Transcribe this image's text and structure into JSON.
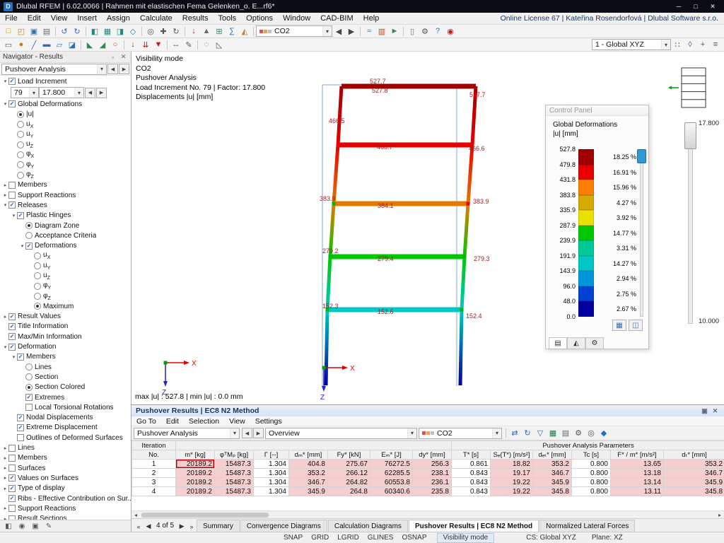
{
  "ui": {
    "combo_arrow": "▾"
  },
  "window": {
    "app_icon": "D",
    "title": "Dlubal RFEM | 6.02.0066 | Rahmen mit elastischen Fema Gelenken_o. E...rf6*",
    "controls": [
      {
        "n": "minimize-button",
        "g": "─"
      },
      {
        "n": "maximize-button",
        "g": "□"
      },
      {
        "n": "close-button",
        "g": "✕"
      }
    ]
  },
  "menu": {
    "items": [
      "File",
      "Edit",
      "View",
      "Insert",
      "Assign",
      "Calculate",
      "Results",
      "Tools",
      "Options",
      "Window",
      "CAD-BIM",
      "Help"
    ],
    "license": "Online License 67 | Kateřina Rosendorfová | Dlubal Software s.r.o."
  },
  "toolbar1": {
    "icons": [
      {
        "n": "new-file-icon",
        "g": "□",
        "c": "#C98A00"
      },
      {
        "n": "open-file-icon",
        "g": "◰",
        "c": "#C98A00"
      },
      {
        "n": "save-icon",
        "g": "▣",
        "c": "#2F6DB5"
      },
      {
        "n": "print-icon",
        "g": "▤",
        "c": "#5A6B7A"
      },
      {
        "sep": true
      },
      {
        "n": "undo-icon",
        "g": "↺",
        "c": "#2F6DB5"
      },
      {
        "n": "redo-icon",
        "g": "↻",
        "c": "#2F6DB5"
      },
      {
        "sep": true
      },
      {
        "n": "navigator-panel-icon",
        "g": "◧",
        "c": "#1F8A8A"
      },
      {
        "n": "tables-panel-icon",
        "g": "▦",
        "c": "#1F8A8A"
      },
      {
        "n": "control-panel-icon",
        "g": "◨",
        "c": "#1F8A8A"
      },
      {
        "n": "render-mode-icon",
        "g": "◇",
        "c": "#2F6DB5"
      },
      {
        "sep": true
      },
      {
        "n": "zoom-icon",
        "g": "◎",
        "c": "#555555"
      },
      {
        "n": "pan-icon",
        "g": "✚",
        "c": "#555555"
      },
      {
        "n": "rotate-view-icon",
        "g": "↻",
        "c": "#555555"
      },
      {
        "sep": true
      },
      {
        "n": "loads-icon",
        "g": "↓",
        "c": "#C01818"
      },
      {
        "n": "supports-icon",
        "g": "▲",
        "c": "#6A6A6A"
      },
      {
        "n": "mesh-icon",
        "g": "⊞",
        "c": "#2E8B57"
      },
      {
        "n": "calculate-icon",
        "g": "∑",
        "c": "#2F6DB5"
      },
      {
        "n": "show-results-icon",
        "g": "◭",
        "c": "#C07818"
      },
      {
        "sep": true
      }
    ],
    "co2_label": "CO2",
    "co2_swatches": [
      "#E05050",
      "#F0A050",
      "#C0C0C0"
    ],
    "icons2": [
      {
        "n": "previous-result-button",
        "g": "◀",
        "c": "#444444"
      },
      {
        "n": "next-result-button",
        "g": "▶",
        "c": "#444444"
      },
      {
        "sep": true
      },
      {
        "n": "result-values-icon",
        "g": "≈",
        "c": "#2F6DB5"
      },
      {
        "n": "colored-diagram-icon",
        "g": "▥",
        "c": "#C04818"
      },
      {
        "n": "animation-icon",
        "g": "►",
        "c": "#2E8B57"
      },
      {
        "sep": true
      },
      {
        "n": "clipboard-icon",
        "g": "▯",
        "c": "#777777"
      },
      {
        "n": "settings-icon",
        "g": "⚙",
        "c": "#555555"
      },
      {
        "n": "help-icon",
        "g": "?",
        "c": "#1F6FC4"
      },
      {
        "n": "search-icon",
        "g": "◉",
        "c": "#C01818"
      }
    ]
  },
  "toolbar2": {
    "icons": [
      {
        "n": "select-arrow-icon",
        "g": "▭",
        "c": "#555555"
      },
      {
        "n": "node-tool-icon",
        "g": "●",
        "c": "#C07818"
      },
      {
        "n": "line-tool-icon",
        "g": "╱",
        "c": "#2F6DB5"
      },
      {
        "n": "member-tool-icon",
        "g": "▬",
        "c": "#2F6DB5"
      },
      {
        "n": "surface-tool-icon",
        "g": "▱",
        "c": "#2F6DB5"
      },
      {
        "n": "solid-tool-icon",
        "g": "◪",
        "c": "#2F6DB5"
      },
      {
        "sep": true
      },
      {
        "n": "nodal-support-icon",
        "g": "◣",
        "c": "#2E8B57"
      },
      {
        "n": "line-support-icon",
        "g": "◢",
        "c": "#2E8B57"
      },
      {
        "n": "member-hinge-icon",
        "g": "○",
        "c": "#C04818"
      },
      {
        "sep": true
      },
      {
        "n": "nodal-load-icon",
        "g": "↓",
        "c": "#C01818"
      },
      {
        "n": "member-load-icon",
        "g": "⇊",
        "c": "#C01818"
      },
      {
        "n": "surface-load-icon",
        "g": "▼",
        "c": "#C01818"
      },
      {
        "sep": true
      },
      {
        "n": "dimension-icon",
        "g": "↔",
        "c": "#555555"
      },
      {
        "n": "annotation-icon",
        "g": "✎",
        "c": "#555555"
      },
      {
        "sep": true
      },
      {
        "n": "visibility-mode-icon",
        "g": "◌",
        "c": "#1F8A8A"
      },
      {
        "n": "section-view-icon",
        "g": "◺",
        "c": "#555555"
      }
    ],
    "cs_label": "1 - Global XYZ",
    "icons2": [
      {
        "n": "grid-settings-icon",
        "g": "∷",
        "c": "#555555"
      },
      {
        "n": "work-plane-icon",
        "g": "◊",
        "c": "#2F6DB5"
      },
      {
        "n": "snap-icon",
        "g": "+",
        "c": "#555555"
      },
      {
        "n": "guidelines-icon",
        "g": "≡",
        "c": "#555555"
      }
    ]
  },
  "navigator": {
    "title": "Navigator - Results",
    "header_icons": [
      {
        "n": "auto-hide-icon",
        "g": "▫",
        "c": "#666666"
      },
      {
        "n": "close-navigator-icon",
        "g": "✕",
        "c": "#666666"
      }
    ],
    "combo": "Pushover Analysis",
    "combo_nav": [
      {
        "n": "previous-analysis-button",
        "g": "◀",
        "c": "#444444"
      },
      {
        "n": "next-analysis-button",
        "g": "▶",
        "c": "#444444"
      }
    ],
    "load_increment": {
      "no": "79",
      "factor": "17.800"
    },
    "glyphs": {
      "expanded": "▾",
      "collapsed": "▸",
      "check": "✓",
      "prev": "◀",
      "next": "▶"
    },
    "items": [
      {
        "t": "c",
        "s": 1,
        "i": 0,
        "l": "Load Increment",
        "e": "v"
      },
      {
        "t": "combo"
      },
      {
        "t": "c",
        "s": 1,
        "i": 0,
        "l": "Global Deformations",
        "e": "v"
      },
      {
        "t": "r",
        "s": 1,
        "i": 1,
        "l": "|u|"
      },
      {
        "t": "r",
        "s": 0,
        "i": 1,
        "l": "u",
        "sub": "X"
      },
      {
        "t": "r",
        "s": 0,
        "i": 1,
        "l": "u",
        "sub": "Y"
      },
      {
        "t": "r",
        "s": 0,
        "i": 1,
        "l": "u",
        "sub": "Z"
      },
      {
        "t": "r",
        "s": 0,
        "i": 1,
        "l": "φ",
        "sub": "X"
      },
      {
        "t": "r",
        "s": 0,
        "i": 1,
        "l": "φ",
        "sub": "Y"
      },
      {
        "t": "r",
        "s": 0,
        "i": 1,
        "l": "φ",
        "sub": "Z"
      },
      {
        "t": "c",
        "s": 0,
        "i": 0,
        "l": "Members",
        "e": ">"
      },
      {
        "t": "c",
        "s": 0,
        "i": 0,
        "l": "Support Reactions",
        "e": ">"
      },
      {
        "t": "c",
        "s": 1,
        "i": 0,
        "l": "Releases",
        "e": "v"
      },
      {
        "t": "c",
        "s": 1,
        "i": 1,
        "l": "Plastic Hinges",
        "e": "v"
      },
      {
        "t": "r",
        "s": 1,
        "i": 2,
        "l": "Diagram Zone"
      },
      {
        "t": "r",
        "s": 0,
        "i": 2,
        "l": "Acceptance Criteria"
      },
      {
        "t": "c",
        "s": 1,
        "i": 2,
        "l": "Deformations",
        "e": "v"
      },
      {
        "t": "r",
        "s": 0,
        "i": 3,
        "l": "u",
        "sub": "X"
      },
      {
        "t": "r",
        "s": 0,
        "i": 3,
        "l": "u",
        "sub": "Y"
      },
      {
        "t": "r",
        "s": 0,
        "i": 3,
        "l": "u",
        "sub": "Z"
      },
      {
        "t": "r",
        "s": 0,
        "i": 3,
        "l": "φ",
        "sub": "Y"
      },
      {
        "t": "r",
        "s": 0,
        "i": 3,
        "l": "φ",
        "sub": "Z"
      },
      {
        "t": "r",
        "s": 1,
        "i": 3,
        "l": "Maximum"
      },
      {
        "t": "c",
        "s": 1,
        "i": 0,
        "l": "Result Values",
        "e": ">"
      },
      {
        "t": "c",
        "s": 1,
        "i": 0,
        "l": "Title Information"
      },
      {
        "t": "c",
        "s": 1,
        "i": 0,
        "l": "Max/Min Information"
      },
      {
        "t": "c",
        "s": 1,
        "i": 0,
        "l": "Deformation",
        "e": "v"
      },
      {
        "t": "c",
        "s": 1,
        "i": 1,
        "l": "Members",
        "e": "v"
      },
      {
        "t": "r",
        "s": 0,
        "i": 2,
        "l": "Lines"
      },
      {
        "t": "r",
        "s": 0,
        "i": 2,
        "l": "Section"
      },
      {
        "t": "r",
        "s": 1,
        "i": 2,
        "l": "Section Colored"
      },
      {
        "t": "c",
        "s": 1,
        "i": 2,
        "l": "Extremes"
      },
      {
        "t": "c",
        "s": 0,
        "i": 2,
        "l": "Local Torsional Rotations"
      },
      {
        "t": "c",
        "s": 1,
        "i": 1,
        "l": "Nodal Displacements"
      },
      {
        "t": "c",
        "s": 1,
        "i": 1,
        "l": "Extreme Displacement"
      },
      {
        "t": "c",
        "s": 0,
        "i": 1,
        "l": "Outlines of Deformed Surfaces"
      },
      {
        "t": "c",
        "s": 0,
        "i": 0,
        "l": "Lines",
        "e": ">"
      },
      {
        "t": "c",
        "s": 0,
        "i": 0,
        "l": "Members",
        "e": ">"
      },
      {
        "t": "c",
        "s": 0,
        "i": 0,
        "l": "Surfaces",
        "e": ">"
      },
      {
        "t": "c",
        "s": 1,
        "i": 0,
        "l": "Values on Surfaces",
        "e": ">"
      },
      {
        "t": "c",
        "s": 1,
        "i": 0,
        "l": "Type of display",
        "e": ">"
      },
      {
        "t": "c",
        "s": 1,
        "i": 0,
        "l": "Ribs - Effective Contribution on Sur..."
      },
      {
        "t": "c",
        "s": 0,
        "i": 0,
        "l": "Support Reactions",
        "e": ">"
      },
      {
        "t": "c",
        "s": 0,
        "i": 0,
        "l": "Result Sections",
        "e": ">"
      }
    ],
    "footer_icons": [
      {
        "n": "panel-layout-icon",
        "g": "◧",
        "c": "#555555"
      },
      {
        "n": "display-properties-icon",
        "g": "◉",
        "c": "#555555"
      },
      {
        "n": "snapshot-icon",
        "g": "▣",
        "c": "#555555"
      },
      {
        "n": "edit-display-icon",
        "g": "✎",
        "c": "#555555"
      }
    ]
  },
  "canvas": {
    "info_lines": [
      "Visibility mode",
      "CO2",
      "Pushover Analysis",
      "Load Increment No. 79 | Factor: 17.800",
      "Displacements |u| [mm]"
    ],
    "stories": [
      {
        "left": "527.7",
        "mid": "527.8",
        "right": "527.7"
      },
      {
        "left": "466.5",
        "mid": "466.7",
        "right": "466.6"
      },
      {
        "left": "383.9",
        "mid": "384.1",
        "right": "383.9"
      },
      {
        "left": "279.2",
        "mid": "279.4",
        "right": "279.3"
      },
      {
        "left": "152.3",
        "mid": "152.6",
        "right": "152.4"
      }
    ],
    "label_colors": {
      "default": "#9C1C1C",
      "max": "#E60000"
    },
    "column_gradient": [
      "#0000A0",
      "#00C8C8",
      "#00C800",
      "#E67800",
      "#E60000",
      "#A00000"
    ],
    "beam_colors": [
      "#A00000",
      "#E60000",
      "#E67800",
      "#00C800",
      "#00C8C8"
    ],
    "hinge_colors": {
      "green": "#00B400",
      "red": "#E60000"
    },
    "undeformed_color": "#7FA8D8",
    "axis": {
      "x": "X",
      "z": "Z"
    },
    "maxmin": "max |u| : 527.8 | min |u| : 0.0 mm",
    "slider": {
      "top": "17.800",
      "bottom": "10.000"
    }
  },
  "control_panel": {
    "title": "Control Panel",
    "subtitle1": "Global Deformations",
    "subtitle2": "|u| [mm]",
    "scale_values": [
      "527.8",
      "479.8",
      "431.8",
      "383.8",
      "335.9",
      "287.9",
      "239.9",
      "191.9",
      "143.9",
      "96.0",
      "48.0",
      "0.0"
    ],
    "scale_percents": [
      "18.25 %",
      "16.91 %",
      "15.96 %",
      "4.27 %",
      "3.92 %",
      "14.77 %",
      "3.31 %",
      "14.27 %",
      "2.94 %",
      "2.75 %",
      "2.67 %"
    ],
    "scale_colors": [
      "#A00000",
      "#E60000",
      "#FF7D00",
      "#D7AA00",
      "#EBE100",
      "#00C800",
      "#00C896",
      "#00C8C8",
      "#0096DC",
      "#0040D2",
      "#0000A0"
    ],
    "buttons": [
      {
        "n": "panel-settings-icon",
        "g": "▦",
        "c": "#2F6DB5"
      },
      {
        "n": "panel-dock-icon",
        "g": "◫",
        "c": "#2F6DB5"
      }
    ],
    "tabs": [
      {
        "n": "tab-color-scale-icon",
        "g": "▤",
        "c": "#333333"
      },
      {
        "n": "tab-factors-icon",
        "g": "◭",
        "c": "#333333"
      },
      {
        "n": "tab-filter-icon",
        "g": "⚙",
        "c": "#333333"
      }
    ]
  },
  "results_panel": {
    "title": "Pushover Results | EC8 N2 Method",
    "title_icons": [
      {
        "n": "maximize-panel-icon",
        "g": "▣",
        "c": "#5A6B7A"
      },
      {
        "n": "close-results-icon",
        "g": "✕",
        "c": "#5A6B7A"
      }
    ],
    "menu": [
      "Go To",
      "Edit",
      "Selection",
      "View",
      "Settings"
    ],
    "combo_analysis": "Pushover Analysis",
    "combo_nav": [
      {
        "n": "previous-table-button",
        "g": "◀",
        "c": "#444444"
      },
      {
        "n": "next-table-button",
        "g": "▶",
        "c": "#444444"
      }
    ],
    "combo_view": "Overview",
    "combo_co2": "CO2",
    "co2_swatches": [
      "#E05050",
      "#F0A050",
      "#C0C0C0"
    ],
    "toolbar_icons": [
      {
        "sep": true
      },
      {
        "n": "sync-selection-icon",
        "g": "⇄",
        "c": "#1F6FC4"
      },
      {
        "n": "refresh-table-icon",
        "g": "↻",
        "c": "#1F6FC4"
      },
      {
        "n": "filter-icon",
        "g": "▽",
        "c": "#1F6FC4"
      },
      {
        "n": "export-excel-icon",
        "g": "▦",
        "c": "#1E7B45"
      },
      {
        "n": "print-table-icon",
        "g": "▤",
        "c": "#5A6B7A"
      },
      {
        "n": "table-settings-icon",
        "g": "⚙",
        "c": "#555555"
      },
      {
        "n": "find-icon",
        "g": "◎",
        "c": "#555555"
      },
      {
        "n": "views-icon",
        "g": "◆",
        "c": "#1F6FC4"
      }
    ],
    "table": {
      "col_top": "Iteration",
      "group_header": "Pushover Analysis Parameters",
      "columns": [
        "No.",
        "m* [kg]",
        "φᵀMₚ [kg]",
        "Γ [--]",
        "dₘ* [mm]",
        "Fy* [kN]",
        "Eₘ* [J]",
        "dy* [mm]",
        "T* [s]",
        "Sₑ(T*) [m/s²]",
        "dₑₜ* [mm]",
        "Tc [s]",
        "F* / m* [m/s²]",
        "dₜ* [mm]"
      ],
      "rows": [
        [
          "1",
          "20189.2",
          "15487.3",
          "1.304",
          "404.8",
          "275.67",
          "76272.5",
          "256.3",
          "0.861",
          "18.82",
          "353.2",
          "0.800",
          "13.65",
          "353.2"
        ],
        [
          "2",
          "20189.2",
          "15487.3",
          "1.304",
          "353.2",
          "266.12",
          "62285.5",
          "238.1",
          "0.843",
          "19.17",
          "346.7",
          "0.800",
          "13.18",
          "346.7"
        ],
        [
          "3",
          "20189.2",
          "15487.3",
          "1.304",
          "346.7",
          "264.82",
          "60553.8",
          "236.1",
          "0.843",
          "19.22",
          "345.9",
          "0.800",
          "13.14",
          "345.9"
        ],
        [
          "4",
          "20189.2",
          "15487.3",
          "1.304",
          "345.9",
          "264.8",
          "60340.6",
          "235.8",
          "0.843",
          "19.22",
          "345.8",
          "0.800",
          "13.11",
          "345.8"
        ]
      ],
      "highlight_cols": [
        1,
        2,
        4,
        5,
        6,
        7,
        9,
        10,
        12,
        13
      ],
      "current_cell": {
        "row": 0,
        "col": 1
      }
    },
    "pager": {
      "label": "4 of 5",
      "first": "«",
      "prev": "◀",
      "next": "▶",
      "last": "»"
    },
    "tabs": [
      "Summary",
      "Convergence Diagrams",
      "Calculation Diagrams",
      "Pushover Results | EC8 N2 Method",
      "Normalized Lateral Forces"
    ],
    "active_tab": 3,
    "scroll": {
      "left": "◂",
      "right": "▸"
    }
  },
  "statusbar": {
    "toggles": [
      "SNAP",
      "GRID",
      "LGRID",
      "GLINES",
      "OSNAP"
    ],
    "mode": "Visibility mode",
    "cs": "CS: Global XYZ",
    "plane": "Plane: XZ"
  }
}
